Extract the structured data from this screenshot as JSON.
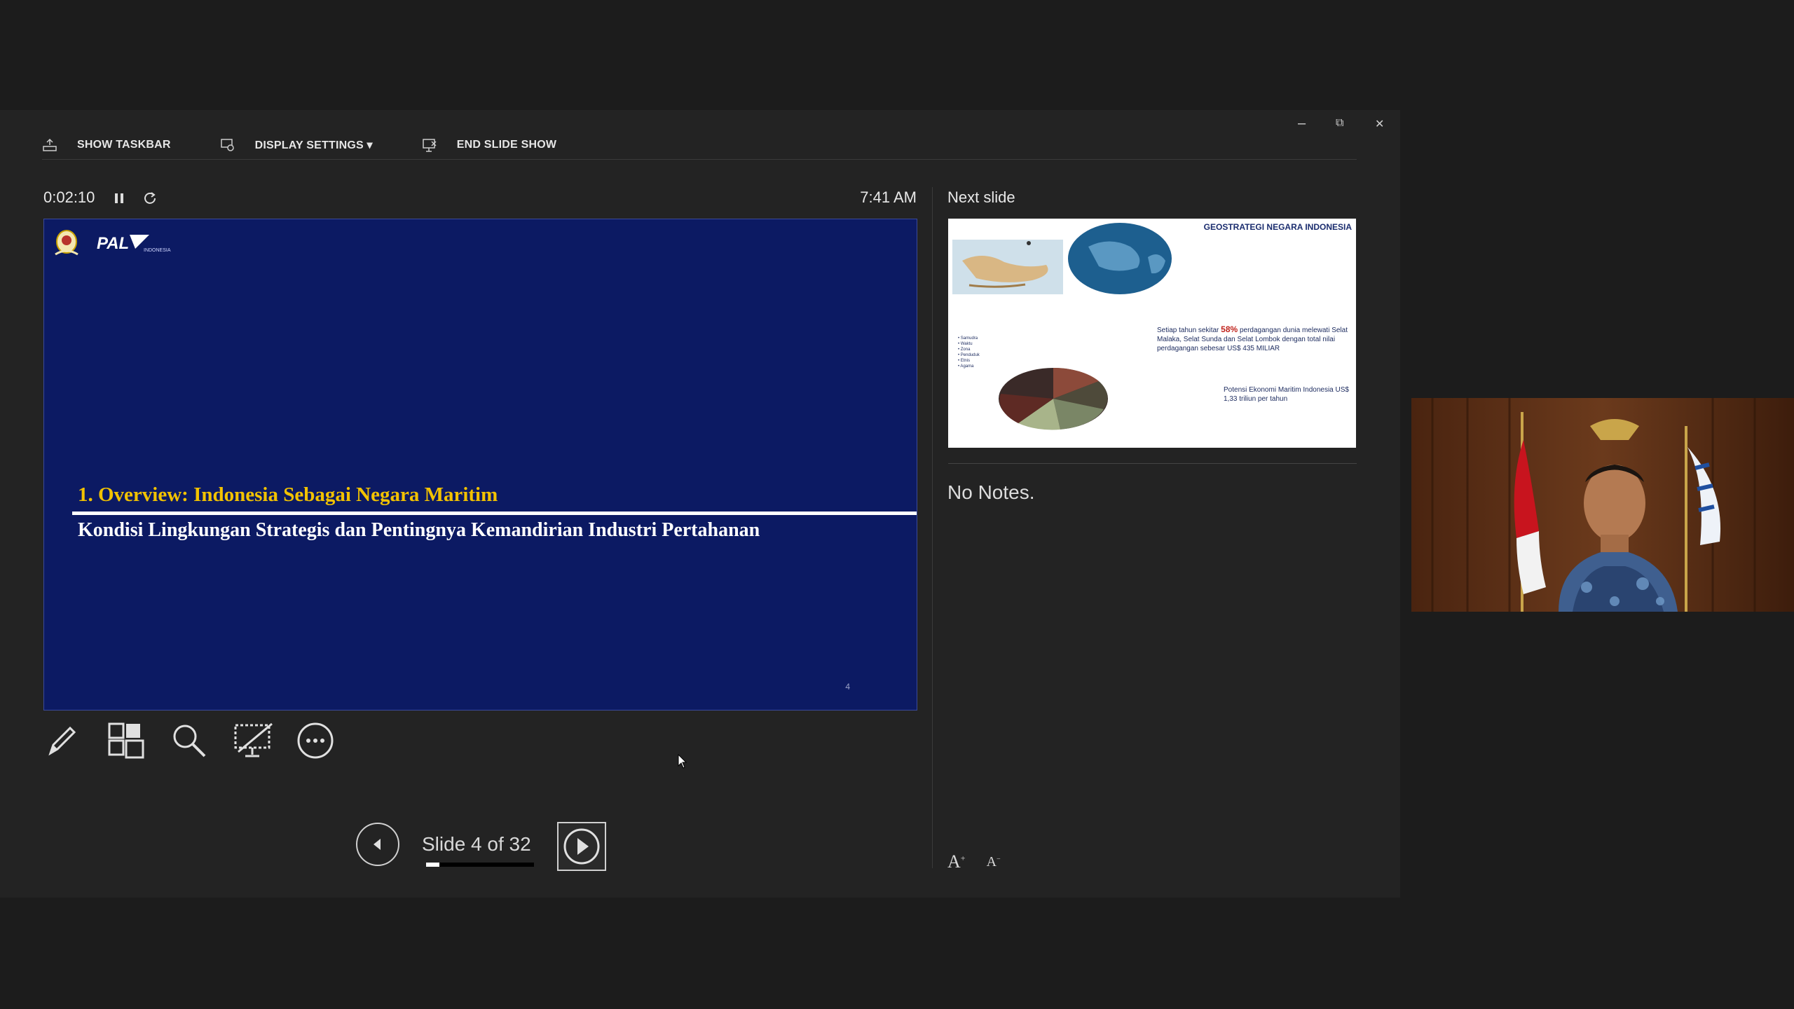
{
  "toolbar": {
    "show_taskbar": "SHOW TASKBAR",
    "display_settings": "DISPLAY SETTINGS ▾",
    "end_slide_show": "END SLIDE SHOW"
  },
  "window_controls": {
    "minimize": "–",
    "restore": "⧉",
    "close": "✕"
  },
  "presenter": {
    "timer": "0:02:10",
    "clock": "7:41 AM",
    "slide_label": "Slide 4 of 32",
    "progress_fraction": 0.125
  },
  "current_slide": {
    "logo_text": "PAL",
    "logo_sub": "INDONESIA",
    "heading": "1. Overview:  Indonesia Sebagai Negara Maritim",
    "subheading": "Kondisi Lingkungan Strategis dan Pentingnya Kemandirian Industri Pertahanan",
    "page_number": "4"
  },
  "next_slide": {
    "title": "Next slide",
    "thumb_title": "GEOSTRATEGI NEGARA INDONESIA",
    "thumb_text_pre": "Setiap tahun sekitar ",
    "thumb_text_hi": "58%",
    "thumb_text_post": " perdagangan dunia melewati Selat Malaka, Selat Sunda dan Selat Lombok dengan total nilai perdagangan sebesar US$ 435 MILIAR",
    "thumb_text2": "Potensi Ekonomi Maritim Indonesia US$ 1,33 triliun  per tahun"
  },
  "notes": {
    "text": "No Notes."
  },
  "colors": {
    "slide_bg": "#0c1a63",
    "heading_gold": "#f2c200",
    "window_bg": "#232323"
  }
}
